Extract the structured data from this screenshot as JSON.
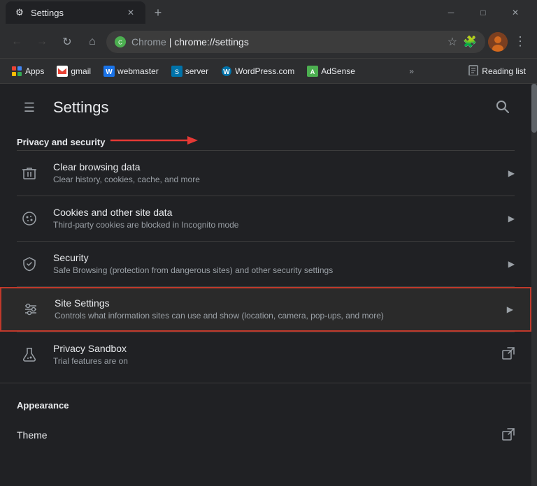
{
  "titlebar": {
    "tab": {
      "title": "Settings",
      "icon": "⚙"
    },
    "new_tab_label": "+",
    "controls": {
      "minimize": "─",
      "maximize": "□",
      "close": "✕"
    }
  },
  "addressbar": {
    "back_btn": "←",
    "forward_btn": "→",
    "refresh_btn": "↻",
    "home_btn": "⌂",
    "url_brand": "Chrome",
    "url_path": "chrome://settings",
    "star_icon": "☆",
    "extension_icon": "🧩",
    "profile_icon": "👤",
    "menu_icon": "⋮"
  },
  "bookmarks": {
    "items": [
      {
        "label": "Apps",
        "icon": "grid"
      },
      {
        "label": "gmail",
        "icon": "gmail"
      },
      {
        "label": "webmaster",
        "icon": "web"
      },
      {
        "label": "server",
        "icon": "server"
      },
      {
        "label": "WordPress.com",
        "icon": "wp"
      },
      {
        "label": "AdSense",
        "icon": "adsense"
      }
    ],
    "more_icon": "»",
    "reading_list_icon": "☰",
    "reading_list_label": "Reading list"
  },
  "settings": {
    "hamburger_icon": "☰",
    "title": "Settings",
    "search_icon": "🔍",
    "section_privacy": "Privacy and security",
    "items": [
      {
        "id": "clear-browsing",
        "icon": "trash",
        "title": "Clear browsing data",
        "subtitle": "Clear history, cookies, cache, and more",
        "action": "arrow"
      },
      {
        "id": "cookies",
        "icon": "cookie",
        "title": "Cookies and other site data",
        "subtitle": "Third-party cookies are blocked in Incognito mode",
        "action": "arrow"
      },
      {
        "id": "security",
        "icon": "shield",
        "title": "Security",
        "subtitle": "Safe Browsing (protection from dangerous sites) and other security settings",
        "action": "arrow"
      },
      {
        "id": "site-settings",
        "icon": "sliders",
        "title": "Site Settings",
        "subtitle": "Controls what information sites can use and show (location, camera, pop-ups, and more)",
        "action": "arrow",
        "highlighted": true
      },
      {
        "id": "privacy-sandbox",
        "icon": "flask",
        "title": "Privacy Sandbox",
        "subtitle": "Trial features are on",
        "action": "external"
      }
    ],
    "section_appearance": "Appearance",
    "appearance_items": [
      {
        "id": "theme",
        "title": "Theme",
        "action": "external"
      }
    ]
  }
}
